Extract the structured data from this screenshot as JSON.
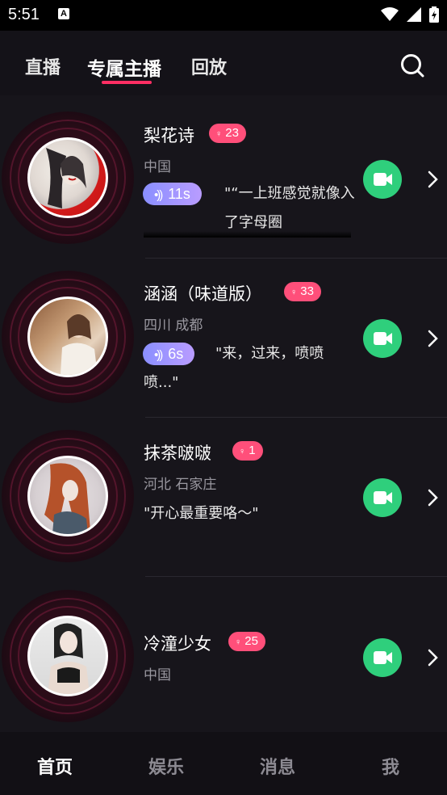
{
  "status": {
    "time": "5:51"
  },
  "tabs": [
    "直播",
    "专属主播",
    "回放"
  ],
  "hosts": [
    {
      "name": "梨花诗",
      "badge": "23",
      "location": "中国",
      "voice": "11s",
      "quote": "\"“一上班感觉就像入了字母圈"
    },
    {
      "name": "涵涵（味道版）",
      "badge": "33",
      "location": "四川 成都",
      "voice": "6s",
      "quote": "\"来，过来，喷喷喷...\""
    },
    {
      "name": "抹茶啵啵",
      "badge": "1",
      "location": "河北 石家庄",
      "voice": "",
      "quote": "\"开心最重要咯～\""
    },
    {
      "name": "冷潼少女",
      "badge": "25",
      "location": "中国",
      "voice": "",
      "quote": ""
    }
  ],
  "gender_symbol": "♀",
  "bottom_tabs": [
    "首页",
    "娱乐",
    "消息",
    "我"
  ],
  "icons": [
    "search-icon",
    "video-camera-icon",
    "chevron-right-icon",
    "voice-wave-icon",
    "wifi-icon",
    "signal-icon",
    "battery-icon"
  ],
  "colors": {
    "accent": "#ff2e63",
    "badge": "#ff4f7a",
    "video": "#2fcf7c",
    "voice_start": "#8a8fff",
    "voice_end": "#b99cff",
    "background": "#17151b"
  }
}
